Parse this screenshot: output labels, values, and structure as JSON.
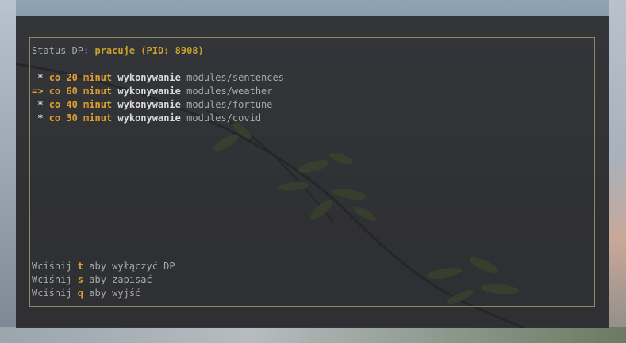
{
  "status": {
    "label": "Status DP: ",
    "value": "pracuje (PID: 8908)"
  },
  "jobs": [
    {
      "prefix": " * ",
      "schedule": "co 20 minut",
      "action": "wykonywanie",
      "module": "modules/sentences"
    },
    {
      "prefix": "=> ",
      "schedule": "co 60 minut",
      "action": "wykonywanie",
      "module": "modules/weather"
    },
    {
      "prefix": " * ",
      "schedule": "co 40 minut",
      "action": "wykonywanie",
      "module": "modules/fortune"
    },
    {
      "prefix": " * ",
      "schedule": "co 30 minut",
      "action": "wykonywanie",
      "module": "modules/covid"
    }
  ],
  "help": [
    {
      "pre": "Wciśnij ",
      "key": "t",
      "post": " aby wyłączyć DP"
    },
    {
      "pre": "Wciśnij ",
      "key": "s",
      "post": " aby zapisać"
    },
    {
      "pre": "Wciśnij ",
      "key": "q",
      "post": " aby wyjść"
    }
  ],
  "colors": {
    "accent": "#e0a030",
    "status": "#c9a227",
    "border": "#8e8866",
    "text": "#aaaaaa"
  }
}
